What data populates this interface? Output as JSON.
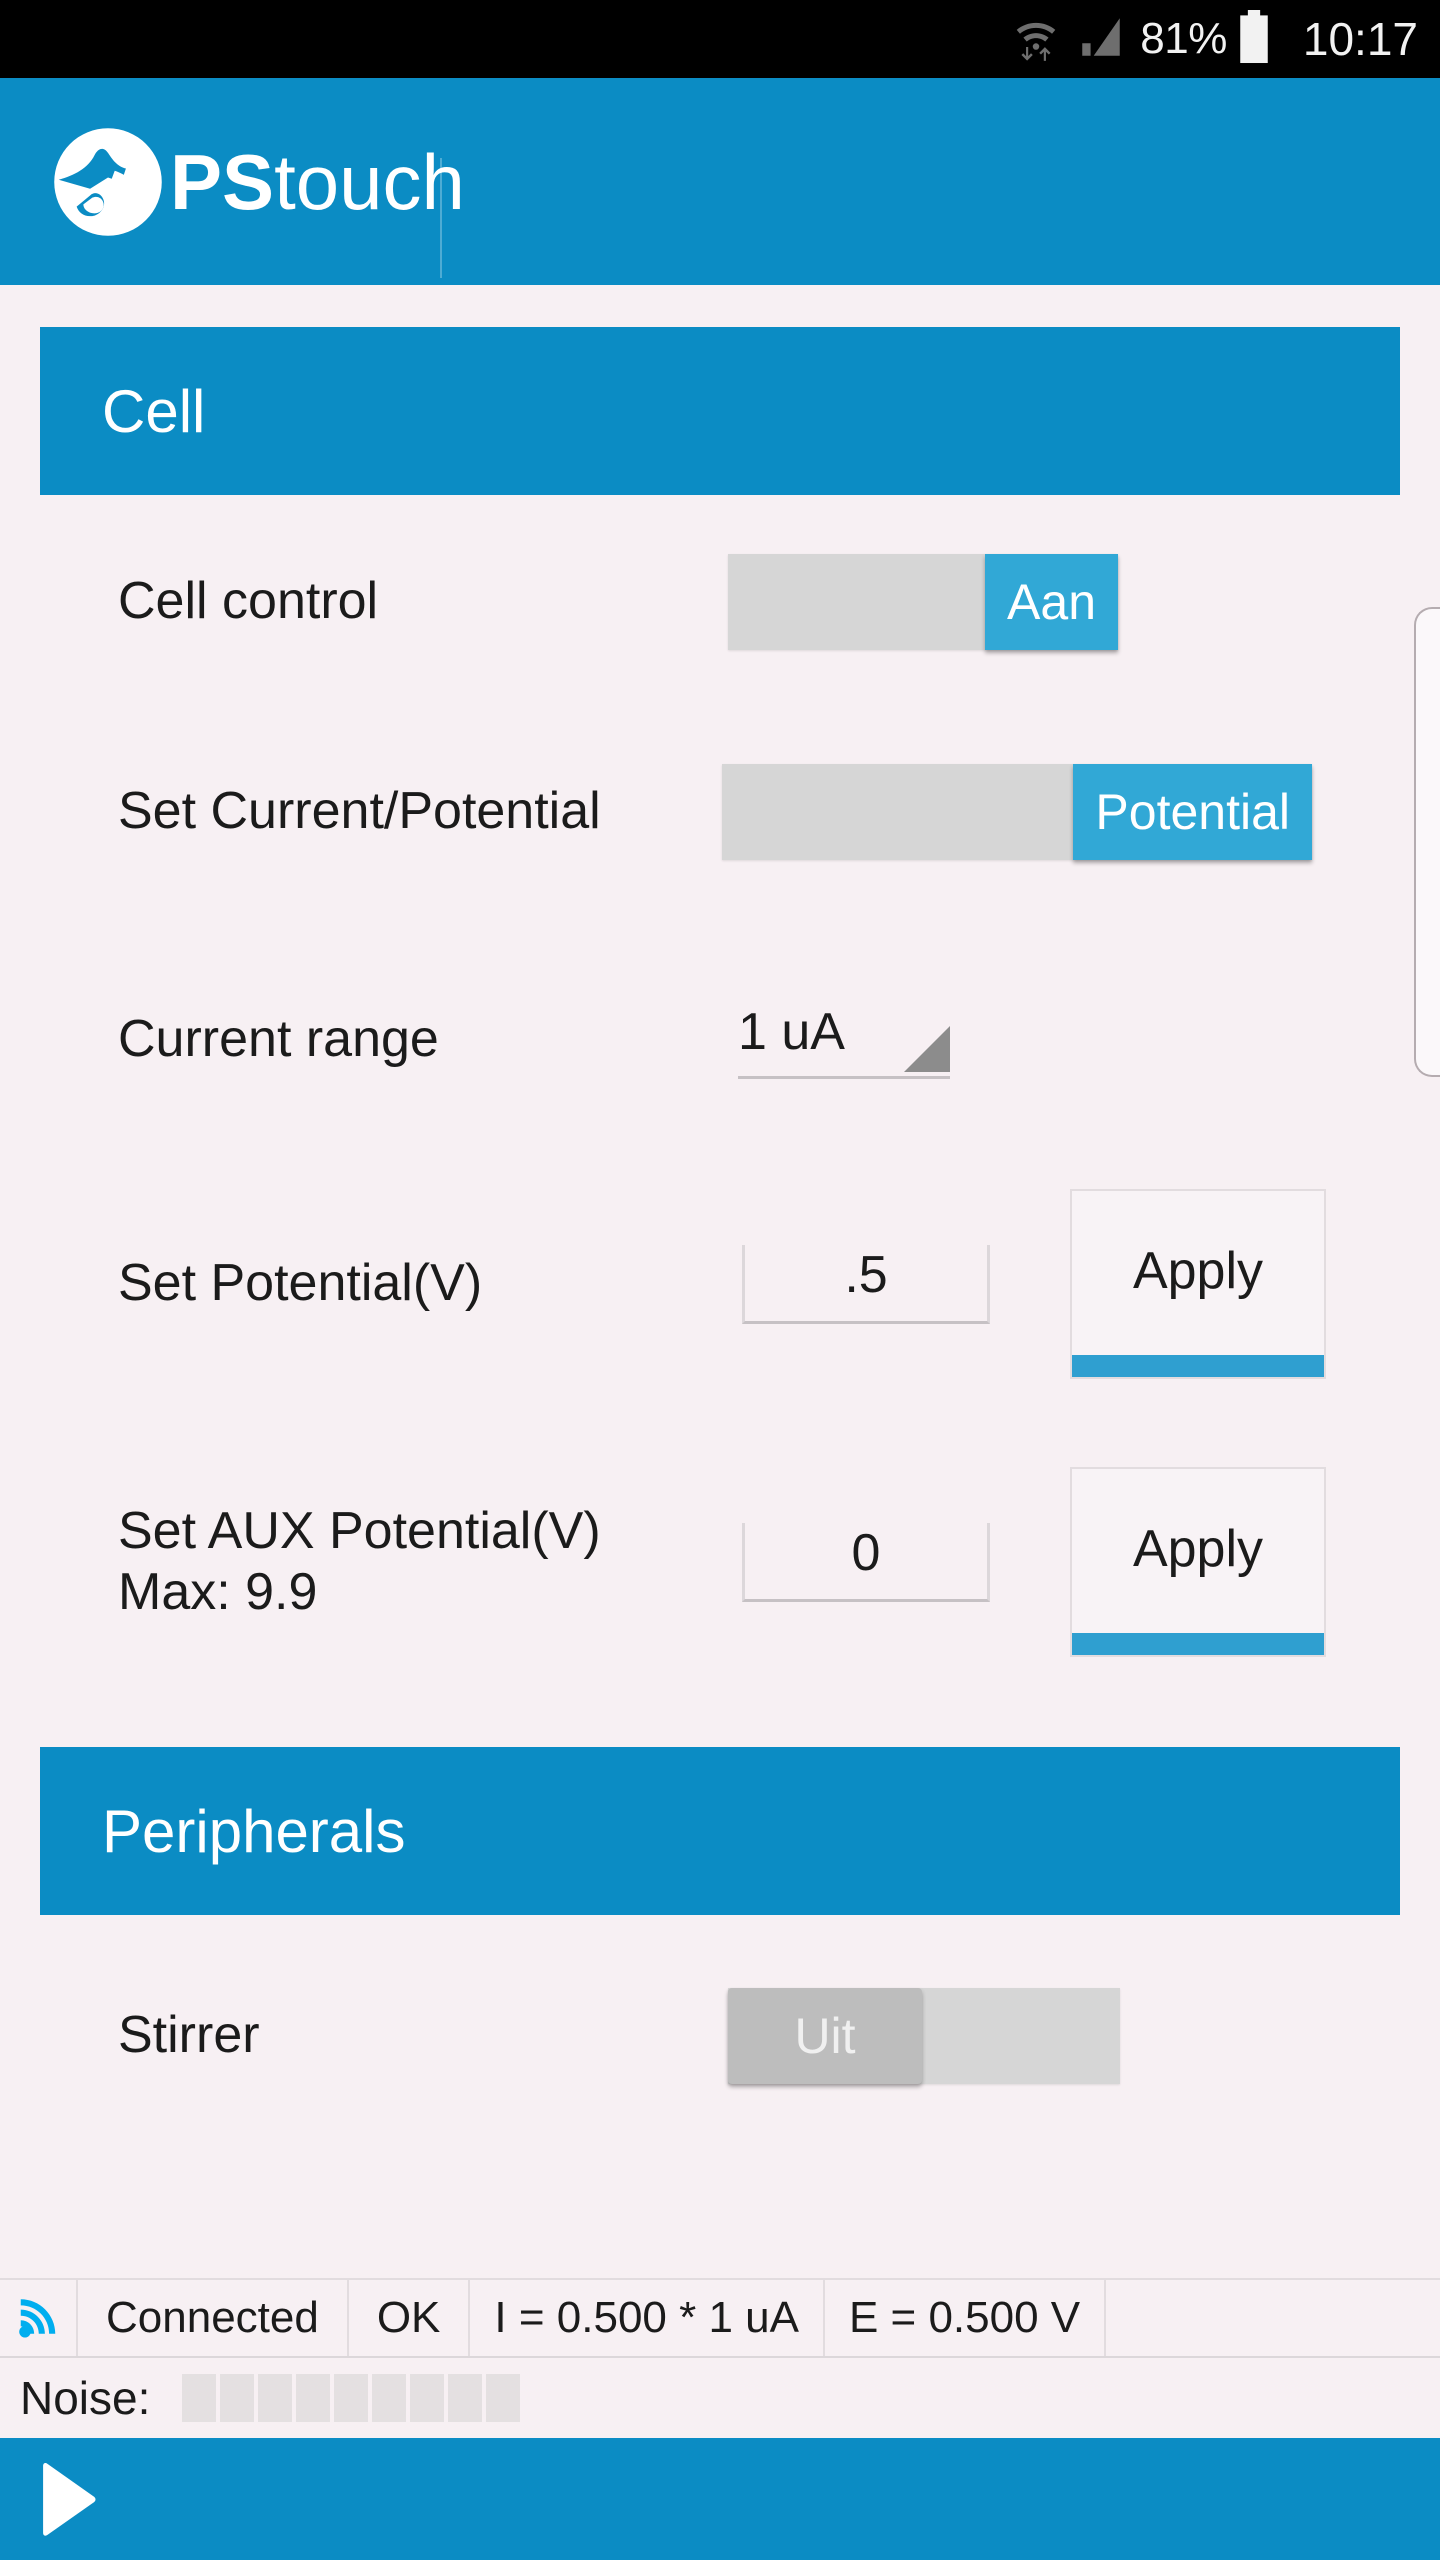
{
  "status_bar": {
    "wifi_icon": "wifi-updown-icon",
    "signal_icon": "cellular-signal-icon",
    "battery_percent": "81%",
    "battery_icon": "battery-icon",
    "clock": "10:17"
  },
  "app_bar": {
    "logo_icon": "pstouch-logo-icon",
    "title_bold": "PS",
    "title_light": "touch"
  },
  "sections": [
    {
      "title": "Cell"
    },
    {
      "title": "Peripherals"
    }
  ],
  "cell": {
    "cell_control": {
      "label": "Cell control",
      "state_label": "Aan",
      "state": "on"
    },
    "set_current_potential": {
      "label": "Set Current/Potential",
      "state_label": "Potential",
      "state": "on"
    },
    "current_range": {
      "label": "Current range",
      "value": "1 uA",
      "arrow_icon": "dropdown-triangle-icon"
    },
    "set_potential": {
      "label": "Set Potential(V)",
      "value": ".5",
      "apply_label": "Apply"
    },
    "set_aux_potential": {
      "label": "Set AUX Potential(V)",
      "sublabel": "Max: 9.9",
      "value": "0",
      "apply_label": "Apply"
    }
  },
  "peripherals": {
    "stirrer": {
      "label": "Stirrer",
      "state_label": "Uit",
      "state": "off"
    }
  },
  "status_strip": {
    "signal_icon": "connection-signal-icon",
    "connection": "Connected",
    "status": "OK",
    "current": "I = 0.500 * 1 uA",
    "potential": "E = 0.500 V"
  },
  "noise": {
    "label": "Noise:",
    "segments_total": 9,
    "segments_filled": 0
  },
  "bottom_bar": {
    "play_icon": "play-icon"
  },
  "colors": {
    "brand_blue": "#0b8cc4",
    "toggle_blue": "#31a8d6",
    "apply_underline": "#2f9fd0",
    "background": "#f7f0f3",
    "toggle_track": "#d6d6d6",
    "toggle_off_thumb": "#bdbdbd"
  }
}
